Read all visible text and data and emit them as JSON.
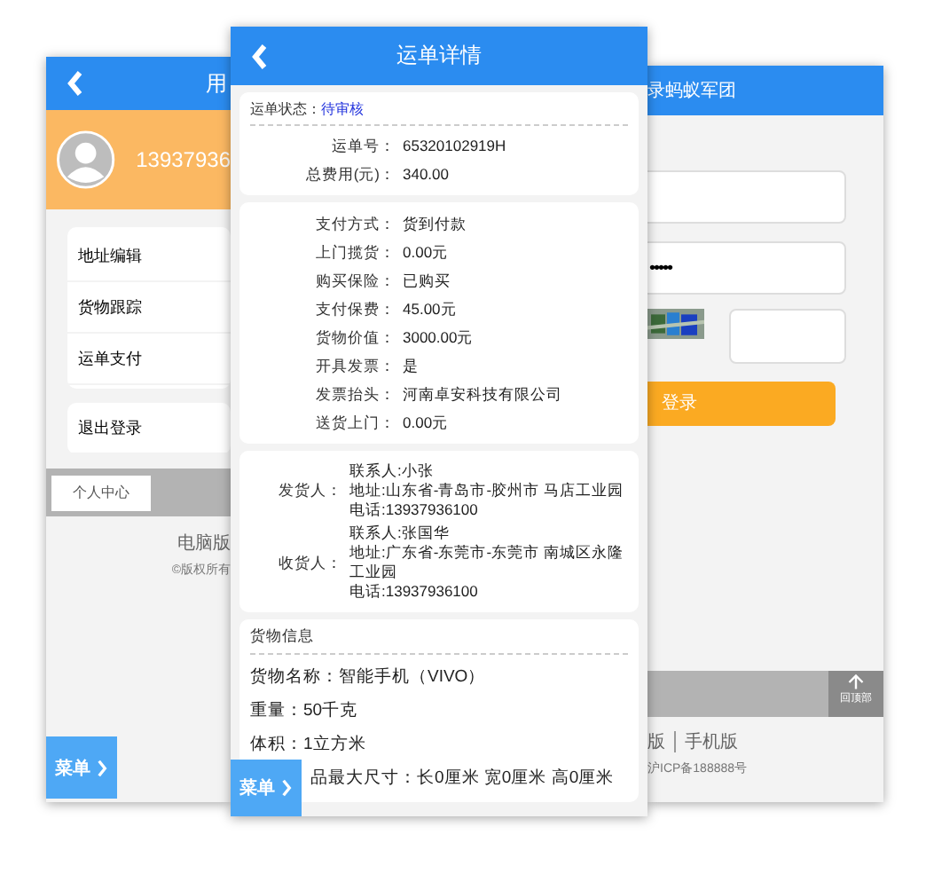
{
  "user_center": {
    "title": "用",
    "phone": "13937936",
    "menu_items": [
      "地址编辑",
      "货物跟踪",
      "运单支付"
    ],
    "logout": "退出登录",
    "tabs": [
      {
        "label": "个人中心",
        "selected": true
      }
    ],
    "footer_link": "电脑版",
    "copyright": "©版权所有",
    "menu_button": "菜单"
  },
  "waybill_detail": {
    "title": "运单详情",
    "status_label": "运单状态：",
    "status": "待审核",
    "summary": [
      {
        "label": "运单号：",
        "value": "65320102919H"
      },
      {
        "label": "总费用(元)：",
        "value": "340.00"
      }
    ],
    "payment": [
      {
        "label": "支付方式：",
        "value": "货到付款"
      },
      {
        "label": "上门揽货：",
        "value": "0.00元"
      },
      {
        "label": "购买保险：",
        "value": "已购买"
      },
      {
        "label": "支付保费：",
        "value": "45.00元"
      },
      {
        "label": "货物价值：",
        "value": "3000.00元"
      },
      {
        "label": "开具发票：",
        "value": "是"
      },
      {
        "label": "发票抬头：",
        "value": "河南卓安科技有限公司"
      },
      {
        "label": "送货上门：",
        "value": "0.00元"
      }
    ],
    "parties": [
      {
        "label": "发货人：",
        "lines": [
          "联系人:小张",
          "地址:山东省-青岛市-胶州市 马店工业园",
          "电话:13937936100"
        ]
      },
      {
        "label": "收货人：",
        "lines": [
          "联系人:张国华",
          "地址:广东省-东莞市-东莞市 南城区永隆工业园",
          "电话:13937936100"
        ]
      }
    ],
    "goods_title": "货物信息",
    "goods": [
      "货物名称：智能手机（VIVO）",
      "重量：50千克",
      "体积：1立方米",
      "品最大尺寸：长0厘米 宽0厘米 高0厘米"
    ],
    "menu_button": "菜单"
  },
  "login": {
    "title": "录蚂蚁军团",
    "password": "•••••",
    "login_button": "登录",
    "back_to_top": "回顶部",
    "footer_link_cut": "版",
    "footer_link": "手机版",
    "icp": "沪ICP备188888号"
  }
}
